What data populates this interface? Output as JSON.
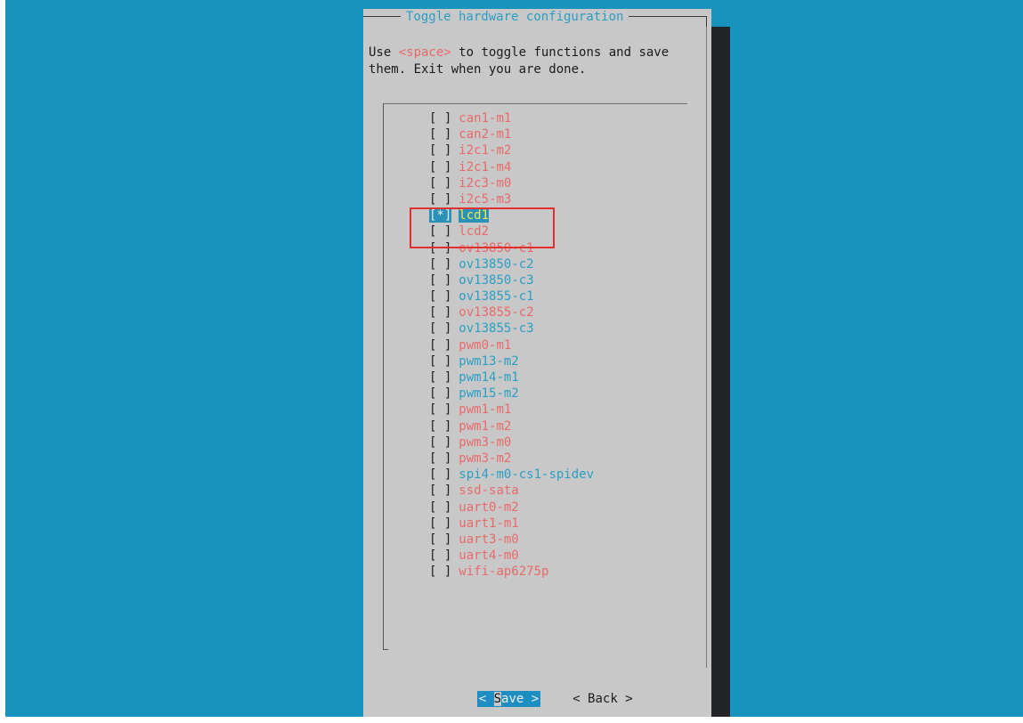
{
  "dialog": {
    "title": "Toggle hardware configuration",
    "prompt_before": "Use ",
    "prompt_key": "<space>",
    "prompt_after": " to toggle functions and save them. Exit when you are done."
  },
  "items": [
    {
      "box": "[ ]",
      "label": "can1-m1",
      "color": "#e96a6a"
    },
    {
      "box": "[ ]",
      "label": "can2-m1",
      "color": "#e96a6a"
    },
    {
      "box": "[ ]",
      "label": "i2c1-m2",
      "color": "#e96a6a"
    },
    {
      "box": "[ ]",
      "label": "i2c1-m4",
      "color": "#e96a6a"
    },
    {
      "box": "[ ]",
      "label": "i2c3-m0",
      "color": "#e96a6a"
    },
    {
      "box": "[ ]",
      "label": "i2c5-m3",
      "color": "#e96a6a"
    },
    {
      "box": "[*]",
      "label": "lcd1",
      "color": "#f5e645",
      "checked": true,
      "selected": true
    },
    {
      "box": "[ ]",
      "label": "lcd2",
      "color": "#e96a6a"
    },
    {
      "box": "[ ]",
      "label": "ov13850-c1",
      "color": "#e96a6a"
    },
    {
      "box": "[ ]",
      "label": "ov13850-c2",
      "color": "#2a9fc5"
    },
    {
      "box": "[ ]",
      "label": "ov13850-c3",
      "color": "#2a9fc5"
    },
    {
      "box": "[ ]",
      "label": "ov13855-c1",
      "color": "#2a9fc5"
    },
    {
      "box": "[ ]",
      "label": "ov13855-c2",
      "color": "#e96a6a"
    },
    {
      "box": "[ ]",
      "label": "ov13855-c3",
      "color": "#2a9fc5"
    },
    {
      "box": "[ ]",
      "label": "pwm0-m1",
      "color": "#e96a6a"
    },
    {
      "box": "[ ]",
      "label": "pwm13-m2",
      "color": "#2a9fc5"
    },
    {
      "box": "[ ]",
      "label": "pwm14-m1",
      "color": "#2a9fc5"
    },
    {
      "box": "[ ]",
      "label": "pwm15-m2",
      "color": "#2a9fc5"
    },
    {
      "box": "[ ]",
      "label": "pwm1-m1",
      "color": "#e96a6a"
    },
    {
      "box": "[ ]",
      "label": "pwm1-m2",
      "color": "#e96a6a"
    },
    {
      "box": "[ ]",
      "label": "pwm3-m0",
      "color": "#e96a6a"
    },
    {
      "box": "[ ]",
      "label": "pwm3-m2",
      "color": "#e96a6a"
    },
    {
      "box": "[ ]",
      "label": "spi4-m0-cs1-spidev",
      "color": "#2a9fc5"
    },
    {
      "box": "[ ]",
      "label": "ssd-sata",
      "color": "#e96a6a"
    },
    {
      "box": "[ ]",
      "label": "uart0-m2",
      "color": "#e96a6a"
    },
    {
      "box": "[ ]",
      "label": "uart1-m1",
      "color": "#e96a6a"
    },
    {
      "box": "[ ]",
      "label": "uart3-m0",
      "color": "#e96a6a"
    },
    {
      "box": "[ ]",
      "label": "uart4-m0",
      "color": "#e96a6a"
    },
    {
      "box": "[ ]",
      "label": "wifi-ap6275p",
      "color": "#e96a6a"
    }
  ],
  "buttons": {
    "save_open": "<",
    "save_hotkey": "S",
    "save_rest": "ave",
    "save_close": ">",
    "back_label": "< Back >"
  },
  "colors": {
    "background": "#1893bd",
    "dialog": "#c8c8c8",
    "selection": "#2a92b8",
    "annotation": "#e03030"
  }
}
